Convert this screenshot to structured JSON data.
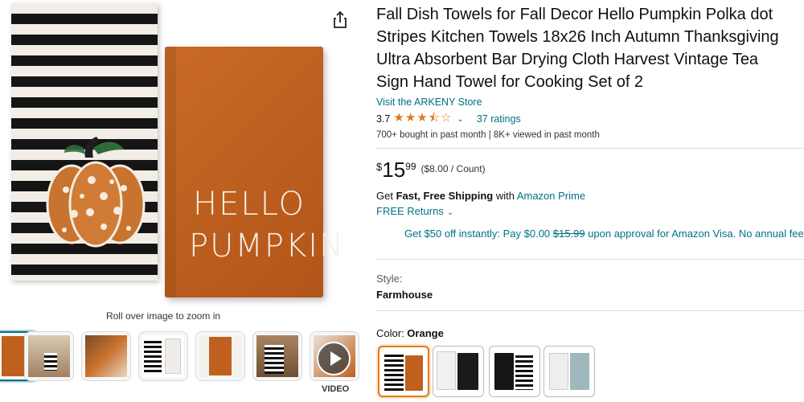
{
  "gallery": {
    "main_towel_text": "HELLO\nPUMPKIN",
    "main_towel_line1": "HELLO",
    "main_towel_line2": "PUMPKIN",
    "zoom_hint": "Roll over image to zoom in",
    "thumbnail_count": 6,
    "video_label": "VIDEO"
  },
  "product": {
    "title_lines": [
      "Fall Dish Towels for Fall Decor Hello Pumpkin Polka dot",
      "Stripes Kitchen Towels 18x26 Inch Autumn Thanksgiving",
      "Ultra Absorbent Bar Drying Cloth Harvest Vintage Tea",
      "Sign Hand Towel for Cooking Set of 2"
    ],
    "store_link": "Visit the ARKENY Store",
    "rating": "3.7",
    "rating_value": 3.7,
    "ratings_count": "37 ratings",
    "bought_info": "700+ bought in past month  |  8K+ viewed in past month"
  },
  "price": {
    "symbol": "$",
    "whole": "15",
    "fraction": "99",
    "unit_price": "($8.00 / Count)"
  },
  "shipping": {
    "prefix": "Get ",
    "bold": "Fast, Free Shipping",
    "middle": " with ",
    "prime_link": "Amazon Prime",
    "returns": "FREE Returns"
  },
  "promo": {
    "text_before": "Get $50 off instantly: Pay $0.00 ",
    "strikethrough": "$15.99",
    "text_after": " upon approval for Amazon Visa. No annual fee."
  },
  "options": {
    "style_label": "Style:",
    "style_value": "Farmhouse",
    "color_label": "Color: ",
    "color_value": "Orange",
    "swatches": [
      {
        "name": "orange",
        "selected": true
      },
      {
        "name": "black-pumpkin",
        "selected": false
      },
      {
        "name": "happy-halloween",
        "selected": false
      },
      {
        "name": "blue-hello-pumpkin",
        "selected": false
      }
    ]
  },
  "colors": {
    "link": "#007185",
    "star": "#de7921",
    "towel_orange": "#c0601f",
    "selected_swatch": "#e47911"
  }
}
